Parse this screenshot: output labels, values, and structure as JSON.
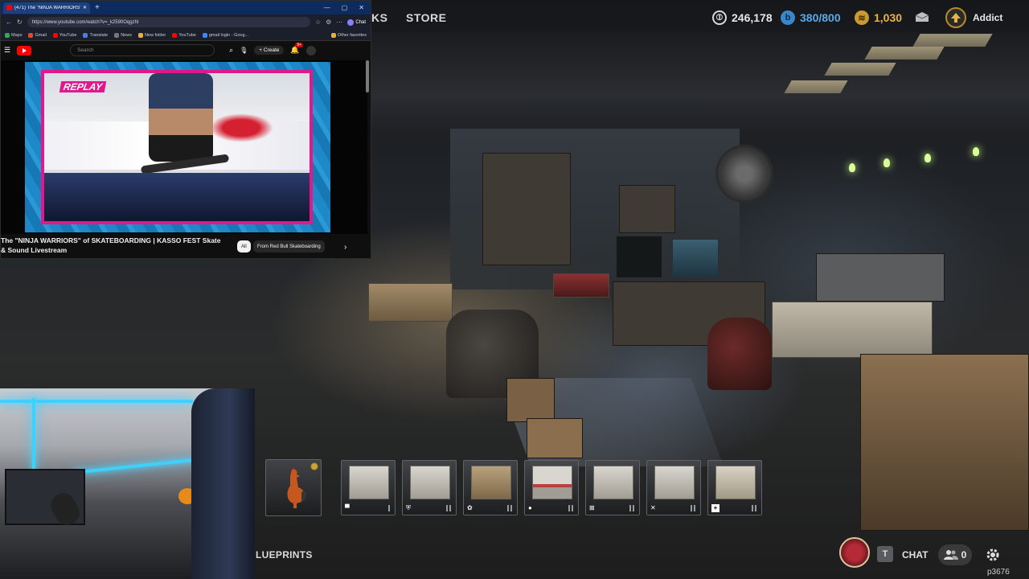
{
  "browser": {
    "tab_title": "(471) The \"NINJA WARRIORS\" of SKATEBOARDING | KASSO FEST",
    "url": "https://www.youtube.com/watch?v=_k2590Oqgzhl",
    "chat_label": "Chat",
    "bookmarks": [
      "Maps",
      "Gmail",
      "YouTube",
      "Translate",
      "News",
      "New folder",
      "YouTube",
      "gmail login - Goog...",
      "Other favorites"
    ]
  },
  "youtube": {
    "search_placeholder": "Search",
    "create_label": "Create",
    "notifications": "9+",
    "replay_label": "REPLAY",
    "video_title": "The \"NINJA WARRIORS\" of SKATEBOARDING | KASSO FEST Skate & Sound Livestream",
    "chips": [
      "All",
      "From Red Bull Skateboarding"
    ]
  },
  "hud": {
    "tab_partial": "KS",
    "store_label": "STORE",
    "currencies": [
      {
        "name": "silver",
        "value": "246,178",
        "color": "#d8d8d8"
      },
      {
        "name": "blue",
        "value": "380/800",
        "color": "#5aa9e6"
      },
      {
        "name": "gold",
        "value": "1,030",
        "color": "#e6b44a"
      }
    ],
    "level_label": "Addict"
  },
  "hotbar": {
    "slots": [
      {
        "name": "rooster",
        "icon": "rooster-icon"
      },
      {
        "name": "workbench-1",
        "icon": "workbench-icon"
      },
      {
        "name": "workbench-2",
        "icon": "shield-icon"
      },
      {
        "name": "workbench-3",
        "icon": "paw-icon"
      },
      {
        "name": "workbench-4",
        "icon": "drop-icon"
      },
      {
        "name": "workbench-5",
        "icon": "crossed-icon"
      },
      {
        "name": "workbench-6",
        "icon": "tools-icon"
      },
      {
        "name": "workbench-7",
        "icon": "plus-icon"
      }
    ]
  },
  "footer": {
    "blueprints_label": "LUEPRINTS",
    "chat_key": "T",
    "chat_label": "CHAT",
    "friends_count": "0",
    "watermark": "p3676"
  }
}
